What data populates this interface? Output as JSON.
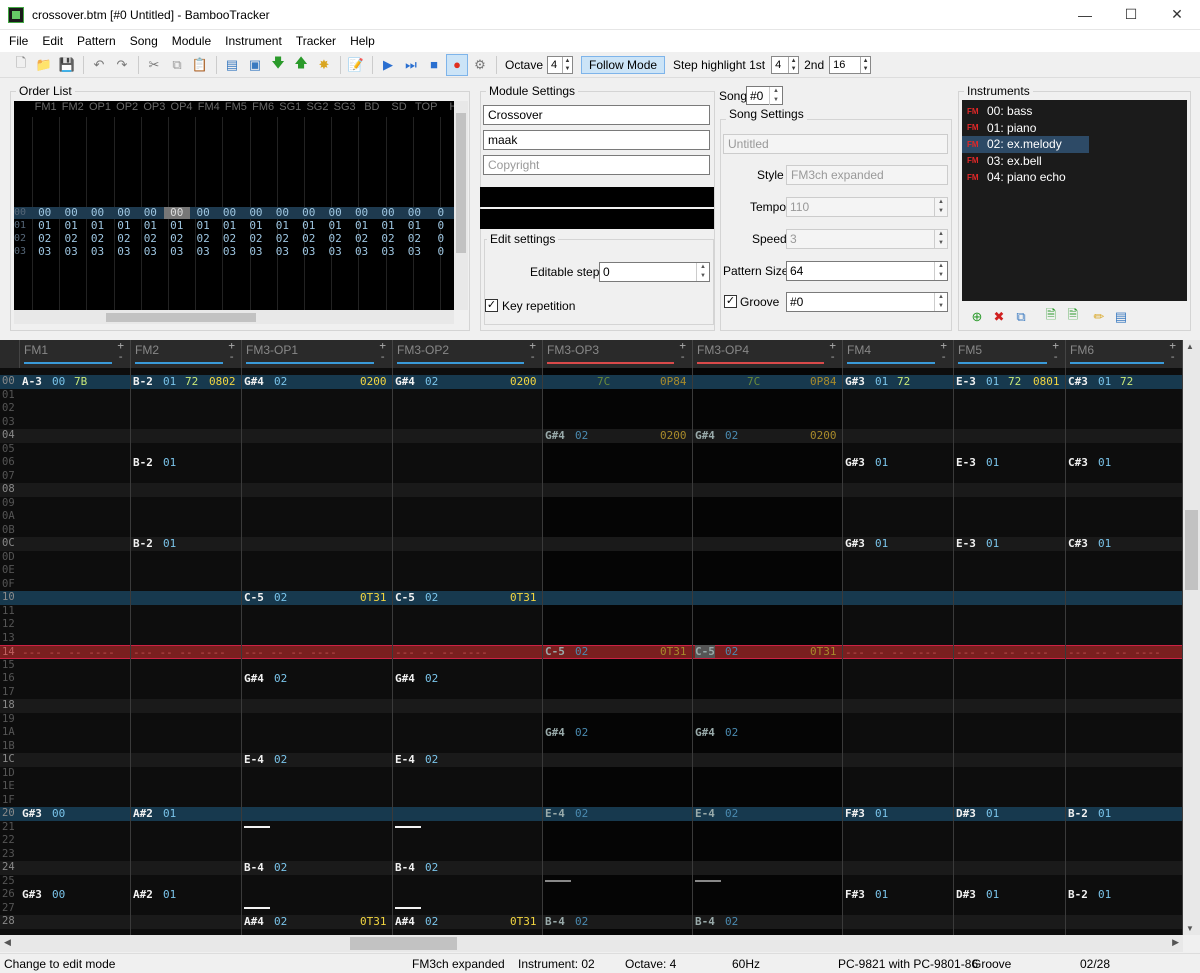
{
  "window": {
    "title": "crossover.btm [#0 Untitled] - BambooTracker"
  },
  "menu": [
    "File",
    "Edit",
    "Pattern",
    "Song",
    "Module",
    "Instrument",
    "Tracker",
    "Help"
  ],
  "toolbar": {
    "octave_label": "Octave",
    "octave": "4",
    "follow_mode": "Follow Mode",
    "step_highlight_label": "Step highlight 1st",
    "step1": "4",
    "second_label": "2nd",
    "step2": "16"
  },
  "order_list": {
    "label": "Order List",
    "columns": [
      "FM1",
      "FM2",
      "OP1",
      "OP2",
      "OP3",
      "OP4",
      "FM4",
      "FM5",
      "FM6",
      "SG1",
      "SG2",
      "SG3",
      "BD",
      "SD",
      "TOP",
      "H"
    ],
    "rows": [
      {
        "num": "00",
        "vals": [
          "00",
          "00",
          "00",
          "00",
          "00",
          "00",
          "00",
          "00",
          "00",
          "00",
          "00",
          "00",
          "00",
          "00",
          "00",
          "0"
        ]
      },
      {
        "num": "01",
        "vals": [
          "01",
          "01",
          "01",
          "01",
          "01",
          "01",
          "01",
          "01",
          "01",
          "01",
          "01",
          "01",
          "01",
          "01",
          "01",
          "0"
        ]
      },
      {
        "num": "02",
        "vals": [
          "02",
          "02",
          "02",
          "02",
          "02",
          "02",
          "02",
          "02",
          "02",
          "02",
          "02",
          "02",
          "02",
          "02",
          "02",
          "0"
        ]
      },
      {
        "num": "03",
        "vals": [
          "03",
          "03",
          "03",
          "03",
          "03",
          "03",
          "03",
          "03",
          "03",
          "03",
          "03",
          "03",
          "03",
          "03",
          "03",
          "0"
        ]
      }
    ]
  },
  "module": {
    "label": "Module Settings",
    "title": "Crossover",
    "author": "maak",
    "copyright_placeholder": "Copyright"
  },
  "edit_settings": {
    "label": "Edit settings",
    "editable_step_label": "Editable step",
    "editable_step": "0",
    "key_repetition": "Key repetition"
  },
  "song": {
    "label": "Song",
    "value": "#0",
    "settings_label": "Song Settings",
    "title_placeholder": "Untitled",
    "style_label": "Style",
    "style": "FM3ch expanded",
    "tempo_label": "Tempo",
    "tempo": "110",
    "speed_label": "Speed",
    "speed": "3",
    "pattern_size_label": "Pattern Size",
    "pattern_size": "64",
    "groove_label": "Groove",
    "groove": "#0"
  },
  "instruments": {
    "label": "Instruments",
    "tag": "FM",
    "items": [
      "00: bass",
      "01: piano",
      "02: ex.melody",
      "03: ex.bell",
      "04: piano echo"
    ]
  },
  "tracks": [
    {
      "name": "FM1",
      "bar": "#3a9ad9"
    },
    {
      "name": "FM2",
      "bar": "#3a9ad9"
    },
    {
      "name": "FM3-OP1",
      "bar": "#3a9ad9"
    },
    {
      "name": "FM3-OP2",
      "bar": "#3a9ad9"
    },
    {
      "name": "FM3-OP3",
      "bar": "#d94a4a"
    },
    {
      "name": "FM3-OP4",
      "bar": "#d94a4a"
    },
    {
      "name": "FM4",
      "bar": "#3a9ad9"
    },
    {
      "name": "FM5",
      "bar": "#3a9ad9"
    },
    {
      "name": "FM6",
      "bar": "#3a9ad9"
    }
  ],
  "row_numbers": [
    "00",
    "01",
    "02",
    "03",
    "04",
    "05",
    "06",
    "07",
    "08",
    "09",
    "0A",
    "0B",
    "0C",
    "0D",
    "0E",
    "0F",
    "10",
    "11",
    "12",
    "13",
    "14",
    "15",
    "16",
    "17",
    "18",
    "19",
    "1A",
    "1B",
    "1C",
    "1D",
    "1E",
    "1F",
    "20",
    "21",
    "22",
    "23",
    "24",
    "25",
    "26",
    "27",
    "28"
  ],
  "cells": [
    {
      "r": 0,
      "c": 0,
      "note": "A-3",
      "inst": "00",
      "vol": "7B",
      "fx": ""
    },
    {
      "r": 0,
      "c": 1,
      "note": "B-2",
      "inst": "01",
      "vol": "72",
      "fx": "0802"
    },
    {
      "r": 0,
      "c": 2,
      "note": "G#4",
      "inst": "02",
      "vol": "",
      "fx": "0200"
    },
    {
      "r": 0,
      "c": 3,
      "note": "G#4",
      "inst": "02",
      "vol": "",
      "fx": "0200"
    },
    {
      "r": 0,
      "c": 4,
      "note": "",
      "inst": "",
      "vol": "7C",
      "fx": "0P84"
    },
    {
      "r": 0,
      "c": 5,
      "note": "",
      "inst": "",
      "vol": "7C",
      "fx": "0P84"
    },
    {
      "r": 0,
      "c": 6,
      "note": "G#3",
      "inst": "01",
      "vol": "72",
      "fx": ""
    },
    {
      "r": 0,
      "c": 7,
      "note": "E-3",
      "inst": "01",
      "vol": "72",
      "fx": "0801"
    },
    {
      "r": 0,
      "c": 8,
      "note": "C#3",
      "inst": "01",
      "vol": "72",
      "fx": ""
    },
    {
      "r": 4,
      "c": 4,
      "note": "G#4",
      "inst": "02",
      "vol": "",
      "fx": "0200"
    },
    {
      "r": 4,
      "c": 5,
      "note": "G#4",
      "inst": "02",
      "vol": "",
      "fx": "0200"
    },
    {
      "r": 6,
      "c": 1,
      "note": "B-2",
      "inst": "01",
      "vol": "",
      "fx": ""
    },
    {
      "r": 6,
      "c": 6,
      "note": "G#3",
      "inst": "01",
      "vol": "",
      "fx": ""
    },
    {
      "r": 6,
      "c": 7,
      "note": "E-3",
      "inst": "01",
      "vol": "",
      "fx": ""
    },
    {
      "r": 6,
      "c": 8,
      "note": "C#3",
      "inst": "01",
      "vol": "",
      "fx": ""
    },
    {
      "r": 12,
      "c": 1,
      "note": "B-2",
      "inst": "01",
      "vol": "",
      "fx": ""
    },
    {
      "r": 12,
      "c": 6,
      "note": "G#3",
      "inst": "01",
      "vol": "",
      "fx": ""
    },
    {
      "r": 12,
      "c": 7,
      "note": "E-3",
      "inst": "01",
      "vol": "",
      "fx": ""
    },
    {
      "r": 12,
      "c": 8,
      "note": "C#3",
      "inst": "01",
      "vol": "",
      "fx": ""
    },
    {
      "r": 16,
      "c": 2,
      "note": "C-5",
      "inst": "02",
      "vol": "",
      "fx": "0T31"
    },
    {
      "r": 16,
      "c": 3,
      "note": "C-5",
      "inst": "02",
      "vol": "",
      "fx": "0T31"
    },
    {
      "r": 20,
      "c": 4,
      "note": "C-5",
      "inst": "02",
      "vol": "",
      "fx": "0T31"
    },
    {
      "r": 20,
      "c": 5,
      "note": "C-5",
      "inst": "02",
      "vol": "",
      "fx": "0T31"
    },
    {
      "r": 22,
      "c": 2,
      "note": "G#4",
      "inst": "02",
      "vol": "",
      "fx": ""
    },
    {
      "r": 22,
      "c": 3,
      "note": "G#4",
      "inst": "02",
      "vol": "",
      "fx": ""
    },
    {
      "r": 26,
      "c": 4,
      "note": "G#4",
      "inst": "02",
      "vol": "",
      "fx": ""
    },
    {
      "r": 26,
      "c": 5,
      "note": "G#4",
      "inst": "02",
      "vol": "",
      "fx": ""
    },
    {
      "r": 28,
      "c": 2,
      "note": "E-4",
      "inst": "02",
      "vol": "",
      "fx": ""
    },
    {
      "r": 28,
      "c": 3,
      "note": "E-4",
      "inst": "02",
      "vol": "",
      "fx": ""
    },
    {
      "r": 32,
      "c": 0,
      "note": "G#3",
      "inst": "00",
      "vol": "",
      "fx": ""
    },
    {
      "r": 32,
      "c": 1,
      "note": "A#2",
      "inst": "01",
      "vol": "",
      "fx": ""
    },
    {
      "r": 32,
      "c": 4,
      "note": "E-4",
      "inst": "02",
      "vol": "",
      "fx": ""
    },
    {
      "r": 32,
      "c": 5,
      "note": "E-4",
      "inst": "02",
      "vol": "",
      "fx": ""
    },
    {
      "r": 32,
      "c": 6,
      "note": "F#3",
      "inst": "01",
      "vol": "",
      "fx": ""
    },
    {
      "r": 32,
      "c": 7,
      "note": "D#3",
      "inst": "01",
      "vol": "",
      "fx": ""
    },
    {
      "r": 32,
      "c": 8,
      "note": "B-2",
      "inst": "01",
      "vol": "",
      "fx": ""
    },
    {
      "r": 36,
      "c": 2,
      "note": "B-4",
      "inst": "02",
      "vol": "",
      "fx": ""
    },
    {
      "r": 36,
      "c": 3,
      "note": "B-4",
      "inst": "02",
      "vol": "",
      "fx": ""
    },
    {
      "r": 38,
      "c": 0,
      "note": "G#3",
      "inst": "00",
      "vol": "",
      "fx": ""
    },
    {
      "r": 38,
      "c": 1,
      "note": "A#2",
      "inst": "01",
      "vol": "",
      "fx": ""
    },
    {
      "r": 38,
      "c": 6,
      "note": "F#3",
      "inst": "01",
      "vol": "",
      "fx": ""
    },
    {
      "r": 38,
      "c": 7,
      "note": "D#3",
      "inst": "01",
      "vol": "",
      "fx": ""
    },
    {
      "r": 38,
      "c": 8,
      "note": "B-2",
      "inst": "01",
      "vol": "",
      "fx": ""
    },
    {
      "r": 40,
      "c": 2,
      "note": "A#4",
      "inst": "02",
      "vol": "",
      "fx": "0T31"
    },
    {
      "r": 40,
      "c": 3,
      "note": "A#4",
      "inst": "02",
      "vol": "",
      "fx": "0T31"
    },
    {
      "r": 40,
      "c": 4,
      "note": "B-4",
      "inst": "02",
      "vol": "",
      "fx": ""
    },
    {
      "r": 40,
      "c": 5,
      "note": "B-4",
      "inst": "02",
      "vol": "",
      "fx": ""
    }
  ],
  "keyoffs": [
    {
      "r": 33,
      "c": 2
    },
    {
      "r": 33,
      "c": 3
    },
    {
      "r": 37,
      "c": 4
    },
    {
      "r": 37,
      "c": 5
    },
    {
      "r": 39,
      "c": 2
    },
    {
      "r": 39,
      "c": 3
    }
  ],
  "cursor_row": "14",
  "cursor_row_index": 20,
  "status": {
    "message": "Change to edit mode",
    "style": "FM3ch expanded",
    "instrument": "Instrument: 02",
    "octave": "Octave: 4",
    "rate": "60Hz",
    "platform": "PC-9821 with PC-9801-86",
    "groove": "Groove",
    "position": "02/28"
  }
}
